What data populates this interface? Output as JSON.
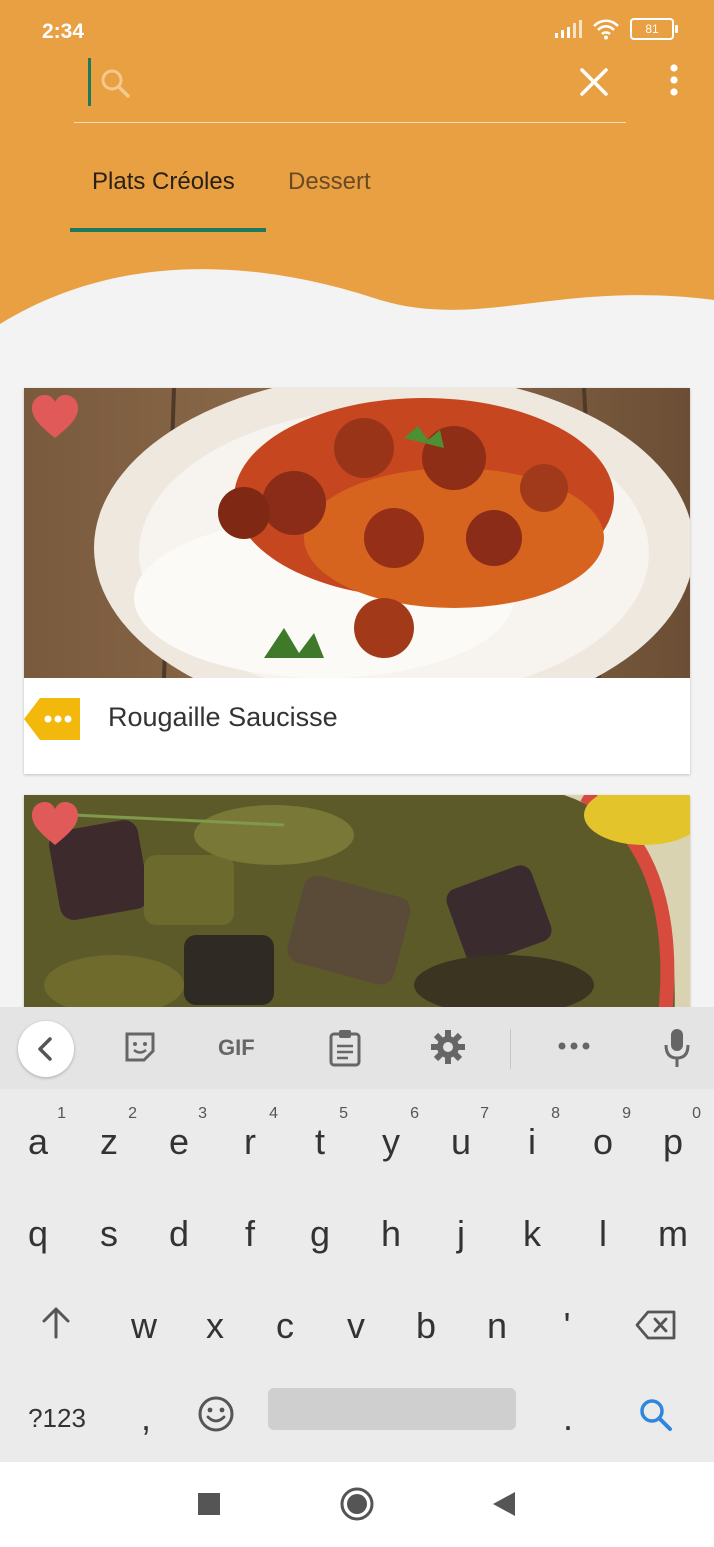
{
  "status_bar": {
    "time": "2:34",
    "battery": "81"
  },
  "search": {
    "value": "",
    "placeholder": ""
  },
  "tabs": [
    {
      "label": "Plats Créoles",
      "active": true
    },
    {
      "label": "Dessert",
      "active": false
    }
  ],
  "recipes": [
    {
      "title": "Rougaille Saucisse",
      "favorite": true
    },
    {
      "title": "",
      "favorite": true
    }
  ],
  "keyboard": {
    "toolbar": [
      "back-icon",
      "sticker-icon",
      "gif",
      "clipboard-icon",
      "settings-icon",
      "more-icon",
      "mic-icon"
    ],
    "gif_label": "GIF",
    "row1": [
      {
        "ch": "a",
        "sup": "1"
      },
      {
        "ch": "z",
        "sup": "2"
      },
      {
        "ch": "e",
        "sup": "3"
      },
      {
        "ch": "r",
        "sup": "4"
      },
      {
        "ch": "t",
        "sup": "5"
      },
      {
        "ch": "y",
        "sup": "6"
      },
      {
        "ch": "u",
        "sup": "7"
      },
      {
        "ch": "i",
        "sup": "8"
      },
      {
        "ch": "o",
        "sup": "9"
      },
      {
        "ch": "p",
        "sup": "0"
      }
    ],
    "row2": [
      "q",
      "s",
      "d",
      "f",
      "g",
      "h",
      "j",
      "k",
      "l",
      "m"
    ],
    "row3": [
      "w",
      "x",
      "c",
      "v",
      "b",
      "n",
      "'"
    ],
    "symbols_label": "?123",
    "comma": ",",
    "period": "."
  },
  "colors": {
    "header": "#e8a043",
    "accent": "#1e7a5c",
    "heart": "#e05a5a",
    "tag": "#f2b90c",
    "search_key": "#2e86de"
  }
}
